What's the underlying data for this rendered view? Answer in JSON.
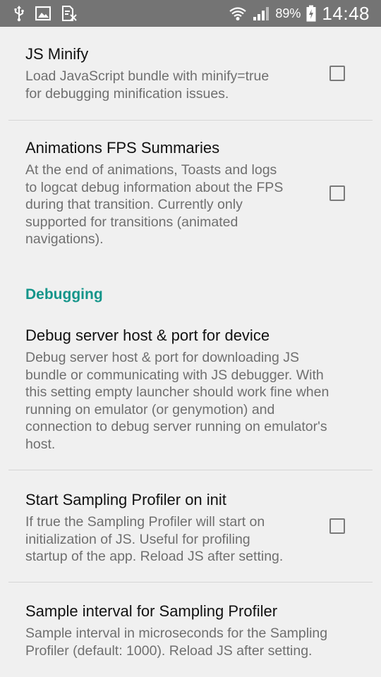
{
  "status_bar": {
    "battery_percent": "89%",
    "time": "14:48"
  },
  "prefs": {
    "js_minify": {
      "title": "JS Minify",
      "summary_line1": "Load JavaScript bundle with minify=true",
      "summary_line2": "for debugging minification issues.",
      "checked": false
    },
    "animations_fps": {
      "title": "Animations FPS Summaries",
      "summary_line1": "At the end of animations, Toasts and logs",
      "summary_line2": "to logcat debug information about the FPS",
      "summary_line3": "during that transition. Currently only",
      "summary_line4": "supported for transitions (animated",
      "summary_line5": "navigations).",
      "checked": false
    },
    "debugging_category": {
      "label": "Debugging"
    },
    "debug_server": {
      "title": "Debug server host & port for device",
      "summary_line1": "Debug server host & port for downloading JS",
      "summary_line2": "bundle or communicating with JS debugger. With",
      "summary_line3": "this setting empty launcher should work fine when",
      "summary_line4": "running on emulator (or genymotion) and",
      "summary_line5": "connection to debug server running on emulator's",
      "summary_line6": "host."
    },
    "sampling_profiler_init": {
      "title": "Start Sampling Profiler on init",
      "summary_line1": "If true the Sampling Profiler will start on",
      "summary_line2": "initialization of JS. Useful for profiling",
      "summary_line3": "startup of the app. Reload JS after setting.",
      "checked": false
    },
    "sample_interval": {
      "title": "Sample interval for Sampling Profiler",
      "summary_line1": "Sample interval in microseconds for the Sampling",
      "summary_line2": "Profiler (default: 1000). Reload JS after setting."
    }
  }
}
